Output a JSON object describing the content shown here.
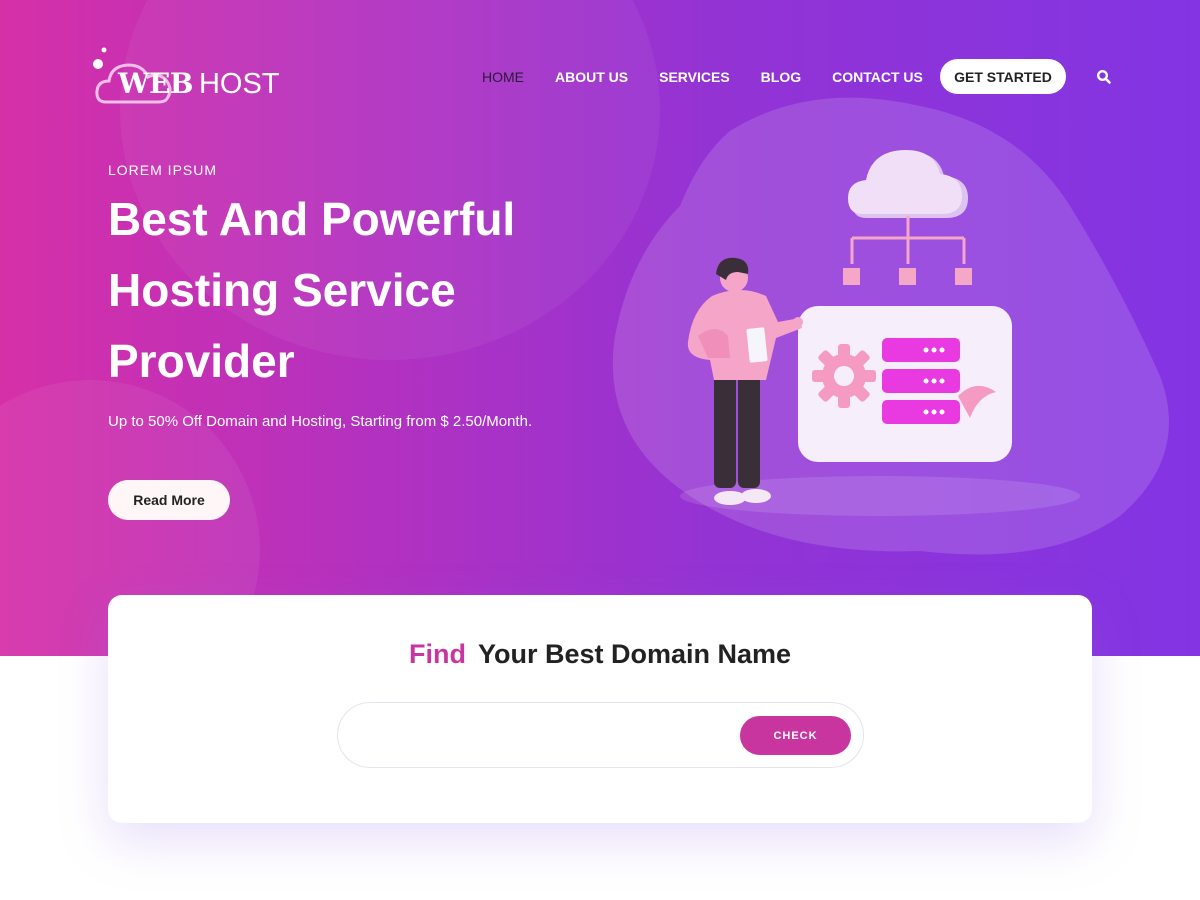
{
  "brand": {
    "web": "WEB",
    "host": "HOST"
  },
  "nav": {
    "items": [
      {
        "label": "HOME"
      },
      {
        "label": "ABOUT US"
      },
      {
        "label": "SERVICES"
      },
      {
        "label": "BLOG"
      },
      {
        "label": "CONTACT US"
      }
    ],
    "cta": "GET STARTED",
    "active": "HOME"
  },
  "hero": {
    "kicker": "LOREM IPSUM",
    "headline_lines": [
      "Best And Powerful",
      "Hosting Service",
      "Provider"
    ],
    "subline": "Up to 50% Off Domain and Hosting, Starting from $ 2.50/Month.",
    "button": "Read More"
  },
  "domain": {
    "title_accent": "Find",
    "title_rest": "Your Best Domain Name",
    "input_value": "",
    "input_placeholder": "",
    "button": "CHECK"
  },
  "colors": {
    "gradient_start": "#d630a8",
    "gradient_end": "#8334e3",
    "accent": "#c8359f"
  },
  "icons": [
    "cloud-logo-icon",
    "search-icon",
    "cloud-icon",
    "gear-icon",
    "server-icon"
  ]
}
